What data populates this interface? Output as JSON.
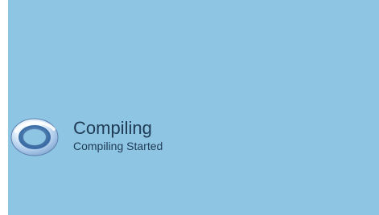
{
  "status": {
    "title": "Compiling",
    "message": "Compiling Started",
    "icon": "progress-ring-icon"
  },
  "colors": {
    "background": "#8ec5e3",
    "text": "#1f3b55",
    "left_strip": "#ffffff"
  }
}
